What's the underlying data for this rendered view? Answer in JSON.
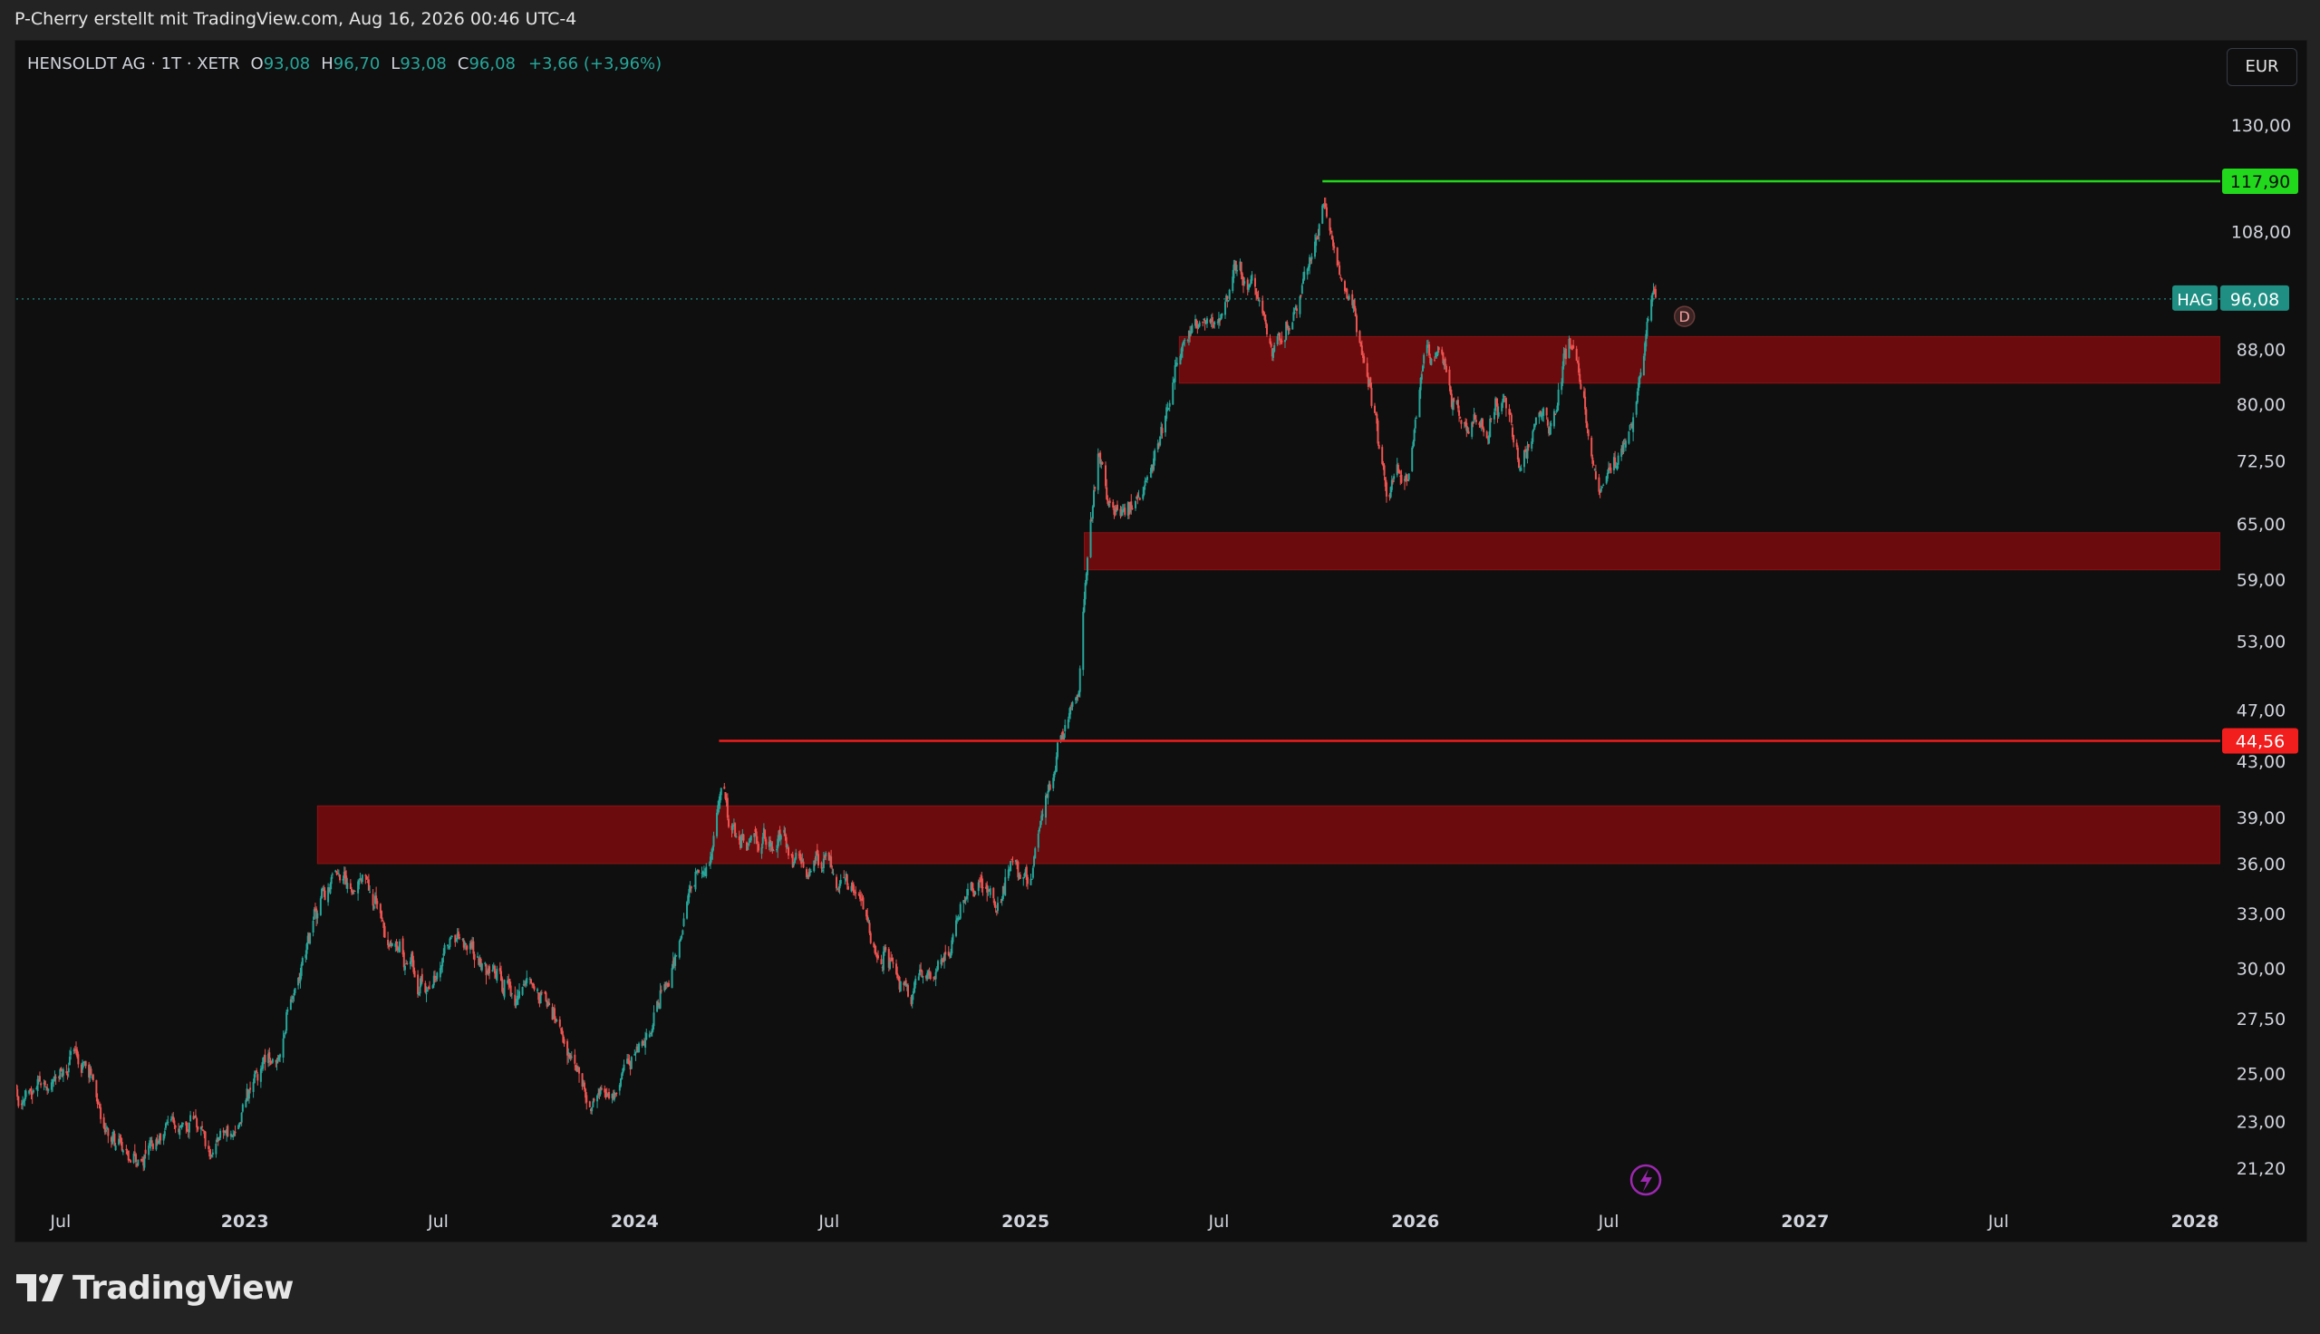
{
  "header": {
    "author_line": "P-Cherry erstellt mit TradingView.com, Aug 16, 2026 00:46 UTC-4"
  },
  "legend": {
    "symbol": "HENSOLDT AG · 1T · XETR",
    "open_label": "O",
    "open": "93,08",
    "high_label": "H",
    "high": "96,70",
    "low_label": "L",
    "low": "93,08",
    "close_label": "C",
    "close": "96,08",
    "change": "+3,66 (+3,96%)"
  },
  "currency_button": "EUR",
  "footer": {
    "brand": "TradingView"
  },
  "colors": {
    "bull": "#26a69a",
    "bear": "#ef5350",
    "zone": "#6b0b0d",
    "resistance_green": "#22d81c",
    "support_red": "#f21d1d",
    "background": "#0f0f0f",
    "marker_purple": "#9c27b0"
  },
  "chart_data": {
    "type": "candlestick",
    "scale": "log",
    "ylim": [
      20.4,
      140
    ],
    "y_ticks": [
      "21,20",
      "23,00",
      "25,00",
      "27,50",
      "30,00",
      "33,00",
      "36,00",
      "39,00",
      "43,00",
      "47,00",
      "53,00",
      "59,00",
      "65,00",
      "72,50",
      "80,00",
      "88,00",
      "108,00",
      "130,00"
    ],
    "y_tick_values": [
      21.2,
      23,
      25,
      27.5,
      30,
      33,
      36,
      39,
      43,
      47,
      53,
      59,
      65,
      72.5,
      80,
      88,
      108,
      130
    ],
    "x_ticks": [
      "Jul",
      "2023",
      "Jul",
      "2024",
      "Jul",
      "2025",
      "Jul",
      "2026",
      "Jul",
      "2027",
      "Jul",
      "2028"
    ],
    "x_tick_dates": [
      "2022-07-01",
      "2023-01-01",
      "2023-07-01",
      "2024-01-01",
      "2024-07-01",
      "2025-01-01",
      "2025-07-01",
      "2026-01-01",
      "2026-07-01",
      "2027-01-01",
      "2027-07-01",
      "2028-01-01"
    ],
    "price_path": [
      [
        "2022-06-01",
        24.5
      ],
      [
        "2022-07-25",
        25.8
      ],
      [
        "2022-08-20",
        23.0
      ],
      [
        "2022-09-25",
        21.5
      ],
      [
        "2022-10-25",
        23.3
      ],
      [
        "2022-11-25",
        22.0
      ],
      [
        "2022-12-20",
        22.8
      ],
      [
        "2023-01-20",
        25.0
      ],
      [
        "2023-02-20",
        29.0
      ],
      [
        "2023-03-15",
        34.5
      ],
      [
        "2023-04-05",
        35.2
      ],
      [
        "2023-04-25",
        35.5
      ],
      [
        "2023-05-20",
        31.0
      ],
      [
        "2023-06-20",
        29.3
      ],
      [
        "2023-07-10",
        31.5
      ],
      [
        "2023-08-10",
        30.5
      ],
      [
        "2023-09-05",
        29.0
      ],
      [
        "2023-10-01",
        28.5
      ],
      [
        "2023-11-01",
        26.0
      ],
      [
        "2023-11-20",
        24.0
      ],
      [
        "2023-12-15",
        24.5
      ],
      [
        "2024-01-15",
        27.0
      ],
      [
        "2024-02-05",
        30.0
      ],
      [
        "2024-02-25",
        35.0
      ],
      [
        "2024-03-10",
        35.5
      ],
      [
        "2024-03-22",
        42.0
      ],
      [
        "2024-04-05",
        38.0
      ],
      [
        "2024-04-25",
        37.0
      ],
      [
        "2024-05-15",
        37.5
      ],
      [
        "2024-06-10",
        35.0
      ],
      [
        "2024-07-01",
        35.5
      ],
      [
        "2024-07-25",
        34.0
      ],
      [
        "2024-08-20",
        31.0
      ],
      [
        "2024-09-15",
        28.0
      ],
      [
        "2024-10-05",
        29.5
      ],
      [
        "2024-10-25",
        32.0
      ],
      [
        "2024-11-20",
        35.0
      ],
      [
        "2024-12-05",
        33.5
      ],
      [
        "2024-12-20",
        36.0
      ],
      [
        "2025-01-05",
        35.0
      ],
      [
        "2025-01-20",
        41.0
      ],
      [
        "2025-02-01",
        44.5
      ],
      [
        "2025-02-20",
        47.5
      ],
      [
        "2025-03-01",
        62.0
      ],
      [
        "2025-03-10",
        74.0
      ],
      [
        "2025-03-20",
        68.0
      ],
      [
        "2025-04-05",
        64.0
      ],
      [
        "2025-04-20",
        68.0
      ],
      [
        "2025-05-05",
        74.0
      ],
      [
        "2025-05-20",
        82.0
      ],
      [
        "2025-06-01",
        88.0
      ],
      [
        "2025-06-15",
        95.0
      ],
      [
        "2025-07-01",
        93.0
      ],
      [
        "2025-07-20",
        102.0
      ],
      [
        "2025-08-05",
        96.0
      ],
      [
        "2025-08-20",
        85.0
      ],
      [
        "2025-09-10",
        94.0
      ],
      [
        "2025-09-25",
        104.0
      ],
      [
        "2025-10-08",
        115.0
      ],
      [
        "2025-10-25",
        99.0
      ],
      [
        "2025-11-10",
        89.0
      ],
      [
        "2025-11-25",
        80.0
      ],
      [
        "2025-12-05",
        69.0
      ],
      [
        "2025-12-25",
        71.0
      ],
      [
        "2026-01-10",
        88.0
      ],
      [
        "2026-01-25",
        84.0
      ],
      [
        "2026-02-10",
        78.0
      ],
      [
        "2026-02-25",
        80.0
      ],
      [
        "2026-03-10",
        75.0
      ],
      [
        "2026-03-25",
        81.0
      ],
      [
        "2026-04-10",
        72.0
      ],
      [
        "2026-04-25",
        78.0
      ],
      [
        "2026-05-10",
        77.0
      ],
      [
        "2026-05-25",
        88.0
      ],
      [
        "2026-06-10",
        78.0
      ],
      [
        "2026-06-25",
        67.0
      ],
      [
        "2026-07-10",
        74.0
      ],
      [
        "2026-07-25",
        80.0
      ],
      [
        "2026-08-05",
        88.0
      ],
      [
        "2026-08-15",
        96.0
      ]
    ],
    "support_resistance_lines": [
      {
        "price": 117.9,
        "label": "117,90",
        "from": "2025-10-06",
        "color": "#22d81c"
      },
      {
        "price": 44.56,
        "label": "44,56",
        "from": "2024-03-20",
        "color": "#f21d1d"
      }
    ],
    "zones": [
      {
        "from": "2023-03-10",
        "low": 36.0,
        "high": 39.8
      },
      {
        "from": "2025-02-25",
        "low": 60.0,
        "high": 64.0
      },
      {
        "from": "2025-05-25",
        "low": 83.0,
        "high": 90.0
      }
    ],
    "last_price": {
      "ticker": "HAG",
      "price": 96.08,
      "label": "96,08"
    },
    "dividend_marker": {
      "date": "2026-09-10",
      "price": 95.0,
      "label": "D"
    }
  }
}
